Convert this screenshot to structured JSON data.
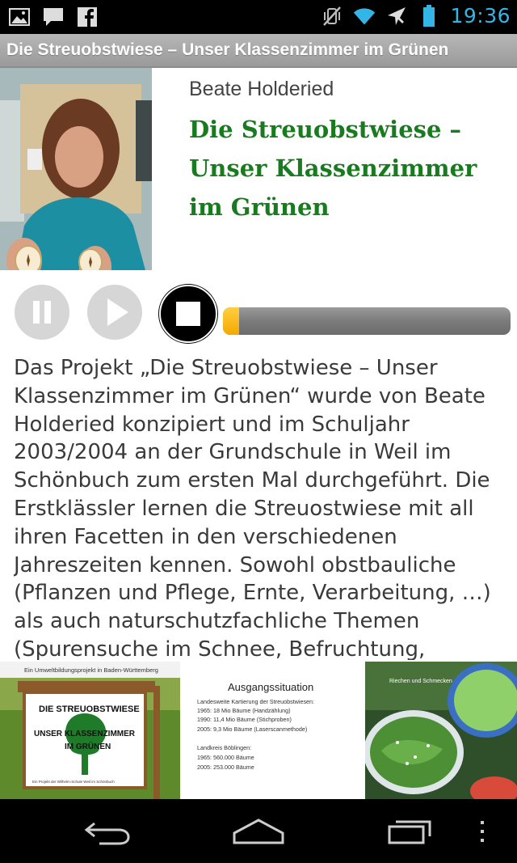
{
  "status_bar": {
    "time": "19:36",
    "left_icons": [
      "image-icon",
      "chat-icon",
      "facebook-icon"
    ],
    "right_icons": [
      "vibrate-off-icon",
      "wifi-icon",
      "airplane-icon",
      "battery-icon"
    ],
    "accent_color": "#33b5e5"
  },
  "title_bar": {
    "title": "Die Streuobstwiese – Unser Klassenzimmer im Grünen"
  },
  "header": {
    "author": "Beate Holderied",
    "title": "Die Streuobstwiese – Unser Klassenzimmer im Grünen",
    "title_color": "#1a7a1f"
  },
  "player": {
    "buttons": [
      "pause",
      "play",
      "stop"
    ],
    "progress_fraction": 0.055,
    "progress_color": "#f5a900"
  },
  "description": "Das Projekt „Die Streuobstwiese – Unser Klassenzimmer im Grünen“ wurde von Beate Holderied konzipiert und im Schuljahr 2003/2004 an der Grundschule in Weil im Schönbuch zum ersten Mal durchgeführt. Die Erstklässler lernen die Streuostwiese mit all ihren Facetten in den verschiedenen Jahreszeiten kennen. Sowohl obstbauliche (Pflanzen und Pflege, Ernte, Verarbeitung, …) als auch naturschutzfachliche Themen (Spurensuche im Schnee, Befruchtung,",
  "gallery": {
    "sign": {
      "caption": "Ein Umweltbildungsprojekt in Baden-Württemberg",
      "line1": "DIE STREUOBSTWIESE",
      "line2": "UNSER KLASSENZIMMER",
      "line3": "IM GRÜNEN",
      "footer": "Ein Projekt der Wilhelm-Schule Weil im Schönbuch"
    },
    "slide": {
      "heading": "Ausgangssituation",
      "lines": [
        "Landesweite Kartierung der Streuobstwiesen:",
        "1965: 18 Mio Bäume  (Handzählung)",
        "1990: 11,4 Mio Bäume (Stichproben)",
        "2005: 9,3 Mio Bäume (Laserscanmethode)",
        "",
        "Landkreis Böblingen:",
        "1965: 560.000 Bäume",
        "2005: 253.000 Bäume"
      ]
    },
    "photo_caption": "Riechen und Schmecken"
  },
  "nav_bar": {
    "buttons": [
      "back",
      "home",
      "recent-apps",
      "menu"
    ]
  }
}
